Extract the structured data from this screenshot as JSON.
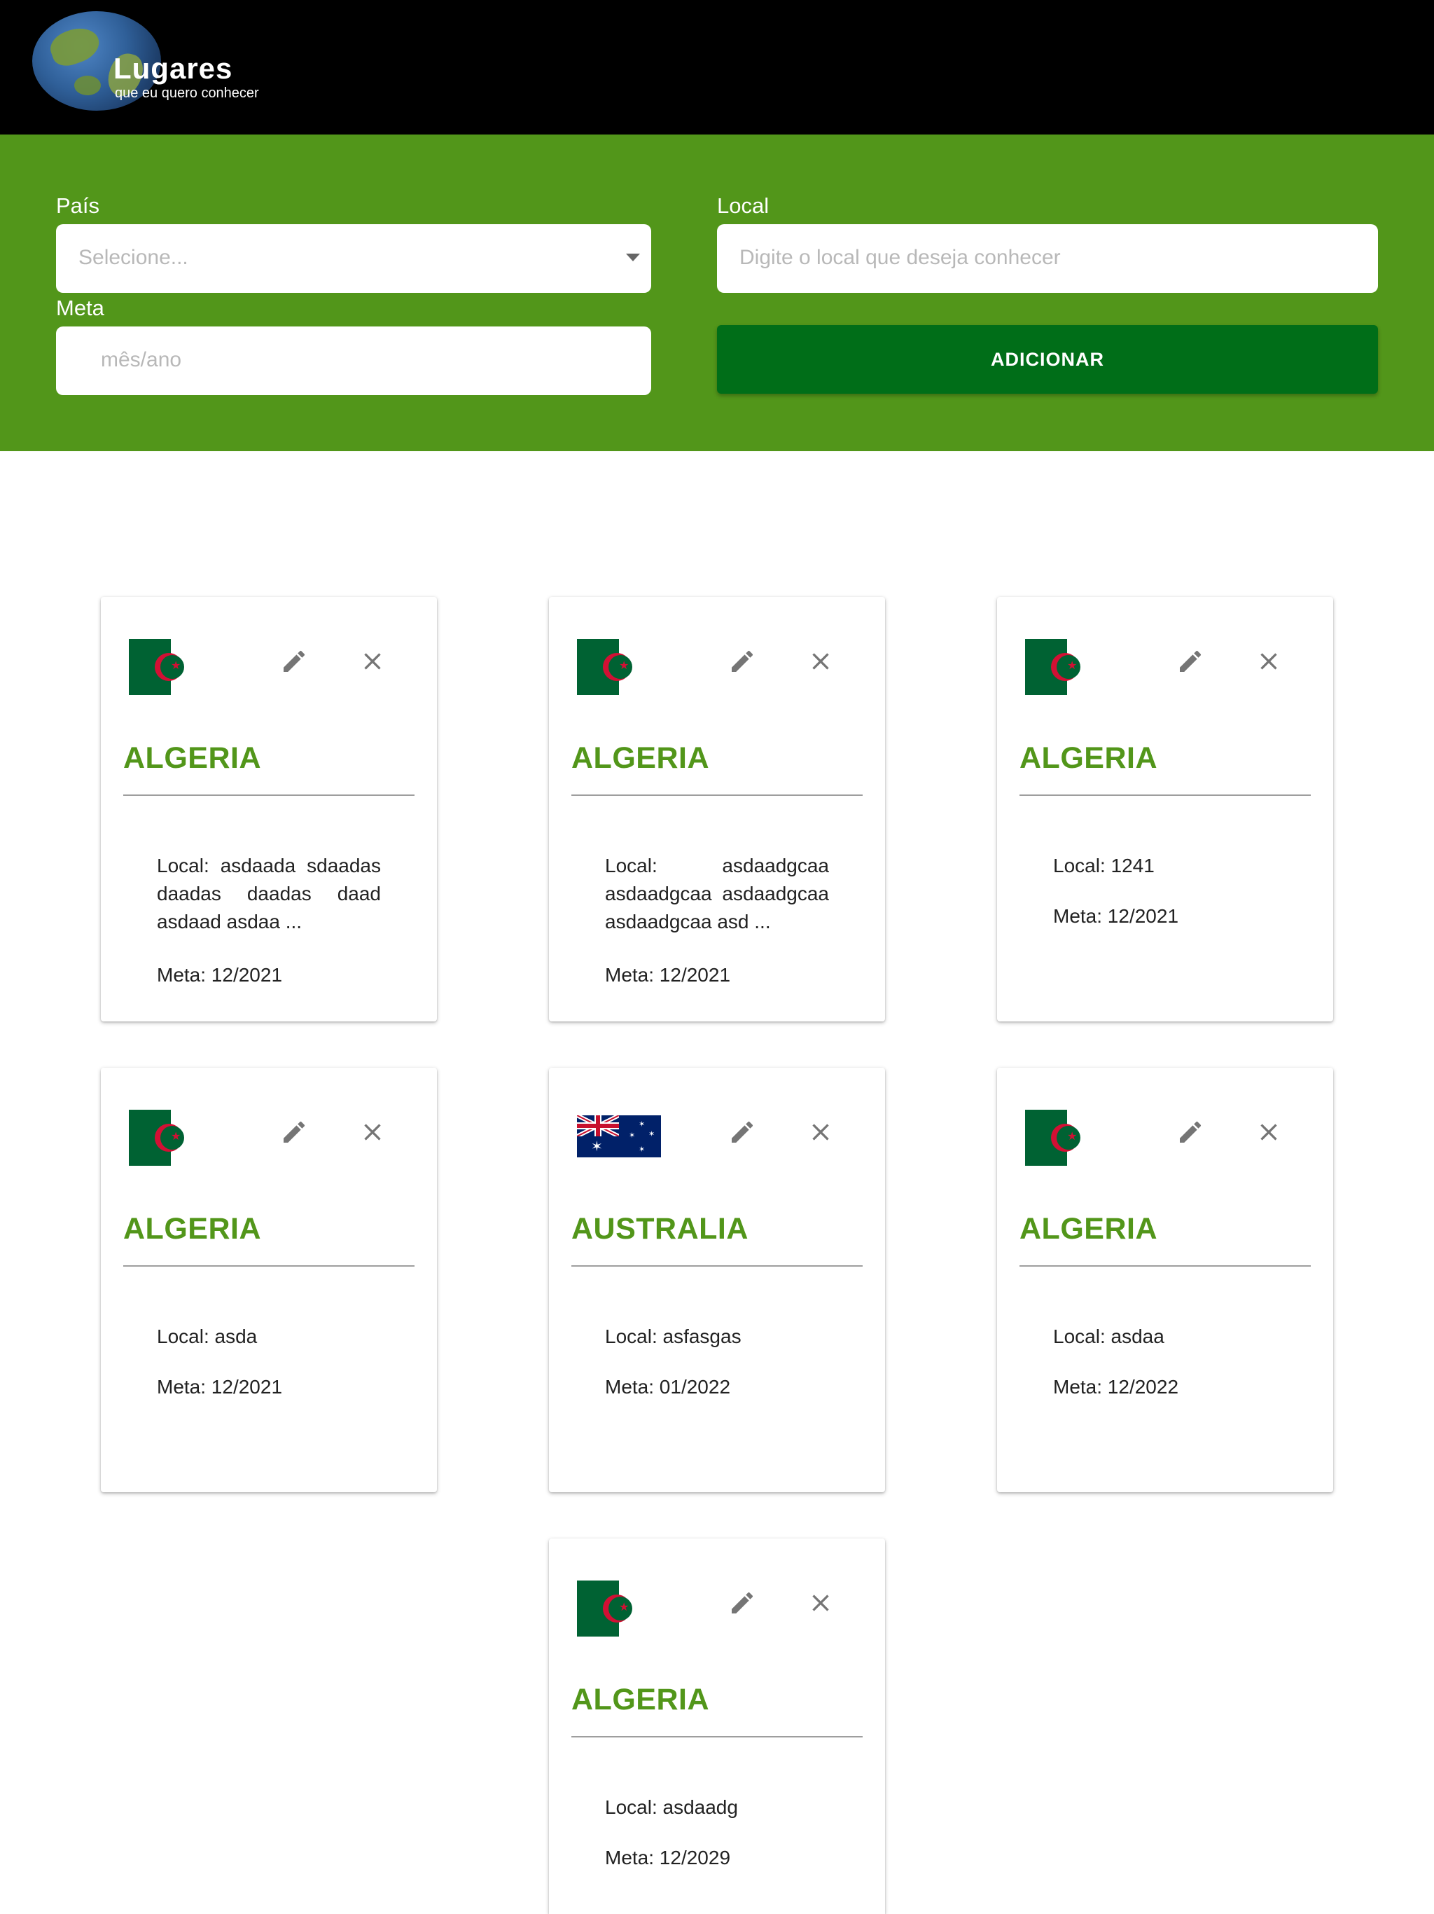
{
  "header": {
    "brand": "Lugares",
    "tagline": "que eu quero conhecer"
  },
  "form": {
    "pais_label": "País",
    "pais_placeholder": "Selecione...",
    "local_label": "Local",
    "local_placeholder": "Digite o local que deseja conhecer",
    "meta_label": "Meta",
    "meta_placeholder": "mês/ano",
    "add_button": "ADICIONAR"
  },
  "cards": [
    {
      "country": "ALGERIA",
      "flag": "algeria-flag",
      "local": "Local: asdaada sdaadas daadas daadas daad asdaad asdaa ...",
      "meta": "Meta: 12/2021"
    },
    {
      "country": "ALGERIA",
      "flag": "algeria-flag",
      "local": "Local: asdaadgcaa asdaadgcaa asdaadgcaa asdaadgcaa asd ...",
      "meta": "Meta: 12/2021"
    },
    {
      "country": "ALGERIA",
      "flag": "algeria-flag",
      "local": "Local: 1241",
      "meta": "Meta: 12/2021"
    },
    {
      "country": "ALGERIA",
      "flag": "algeria-flag",
      "local": "Local: asda",
      "meta": "Meta: 12/2021"
    },
    {
      "country": "AUSTRALIA",
      "flag": "australia-flag",
      "local": "Local: asfasgas",
      "meta": "Meta: 01/2022"
    },
    {
      "country": "ALGERIA",
      "flag": "algeria-flag",
      "local": "Local: asdaa",
      "meta": "Meta: 12/2022"
    },
    {
      "country": "ALGERIA",
      "flag": "algeria-flag",
      "local": "Local: asdaadg",
      "meta": "Meta: 12/2029"
    }
  ],
  "icons": {
    "edit": "pencil-icon",
    "delete": "close-icon"
  },
  "colors": {
    "header_bg": "#000000",
    "form_bg": "#52961a",
    "button_bg": "#006e18",
    "country_text": "#52961a"
  }
}
